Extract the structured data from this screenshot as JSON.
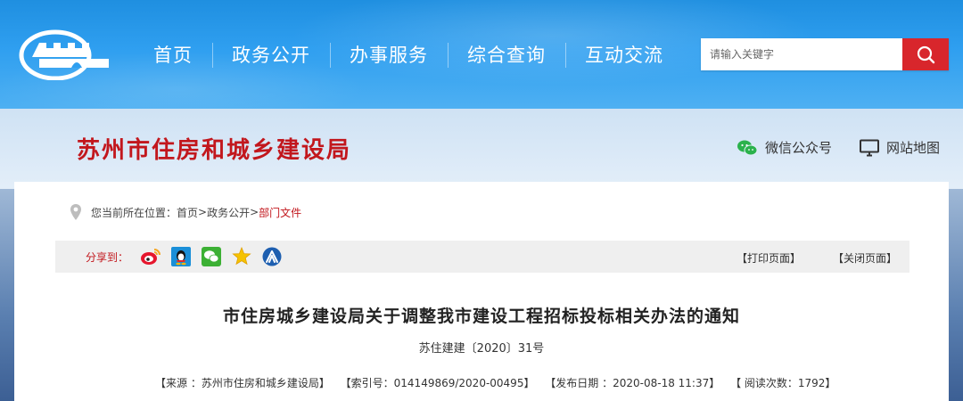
{
  "nav": {
    "items": [
      "首页",
      "政务公开",
      "办事服务",
      "综合查询",
      "互动交流"
    ]
  },
  "search": {
    "placeholder": "请输入关键字"
  },
  "header": {
    "site_title": "苏州市住房和城乡建设局",
    "wechat_label": "微信公众号",
    "sitemap_label": "网站地图"
  },
  "breadcrumb": {
    "prefix": "您当前所在位置：",
    "items": [
      "首页",
      "政务公开",
      "部门文件"
    ],
    "separator": ">"
  },
  "share": {
    "label": "分享到：",
    "icons": [
      "weibo-icon",
      "qq-icon",
      "wechat-icon",
      "qzone-star-icon",
      "renren-icon"
    ],
    "print_label": "【打印页面】",
    "close_label": "【关闭页面】"
  },
  "article": {
    "title": "市住房城乡建设局关于调整我市建设工程招标投标相关办法的通知",
    "doc_number": "苏住建建〔2020〕31号",
    "source": "【来源 ：苏州市住房和城乡建设局】",
    "index_no": "【索引号：014149869/2020-00495】",
    "publish_date": "【发布日期 ：2020-08-18 11:37】",
    "views": "【 阅读次数：1792】"
  },
  "colors": {
    "nav_blue": "#2f9ff0",
    "brand_red": "#c2171d",
    "search_button": "#d8262c"
  }
}
